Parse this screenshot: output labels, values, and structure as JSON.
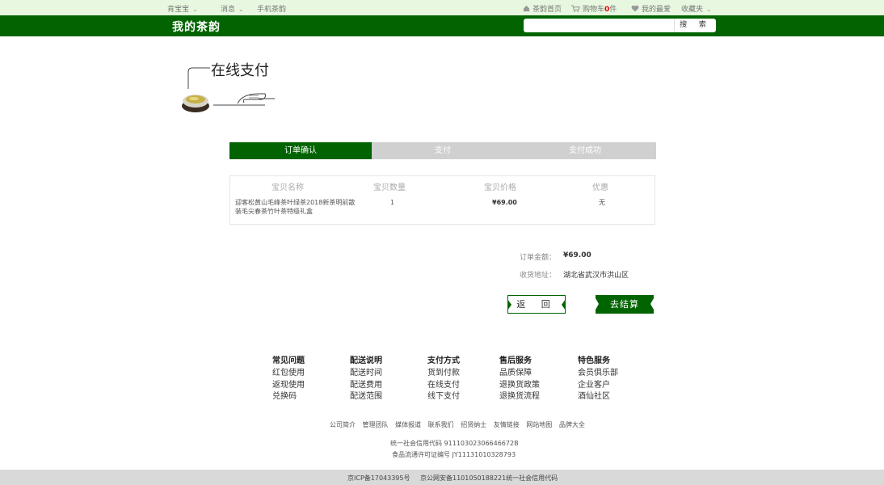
{
  "topbar": {
    "left_items": [
      "肯宝宝",
      "消息",
      "手机茶韵"
    ],
    "home_label": "茶韵首页",
    "cart_label": "购物车",
    "cart_count": "0",
    "cart_unit": "件",
    "favorite_label": "我的最爱",
    "collect_label": "收藏夹"
  },
  "header": {
    "brand": "我的茶韵",
    "search_placeholder": "",
    "search_button": "搜 索"
  },
  "page_title": "在线支付",
  "steps": [
    {
      "label": "订单确认",
      "active": true
    },
    {
      "label": "支付",
      "active": false
    },
    {
      "label": "支付成功",
      "active": false
    }
  ],
  "order_table": {
    "headers": [
      "宝贝名称",
      "宝贝数量",
      "宝贝价格",
      "优惠"
    ],
    "row": {
      "name_line1": "迎客松黄山毛峰茶叶绿茶2018新茶明前散",
      "name_line2": "装毛尖春茶竹叶茶特级礼盒",
      "quantity": "1",
      "price": "¥69.00",
      "discount": "无"
    }
  },
  "summary": {
    "amount_label": "订单金额：",
    "amount_value": "¥69.00",
    "address_label": "收货地址：",
    "address_value": "湖北省武汉市洪山区"
  },
  "buttons": {
    "back": "返 回",
    "checkout": "去结算"
  },
  "footer": {
    "columns": [
      {
        "title": "常见问题",
        "links": [
          "红包使用",
          "返现使用",
          "兑换码"
        ]
      },
      {
        "title": "配送说明",
        "links": [
          "配送时间",
          "配送费用",
          "配送范围"
        ]
      },
      {
        "title": "支付方式",
        "links": [
          "货到付款",
          "在线支付",
          "线下支付"
        ]
      },
      {
        "title": "售后服务",
        "links": [
          "品质保障",
          "退换货政策",
          "退换货流程"
        ]
      },
      {
        "title": "特色服务",
        "links": [
          "会员俱乐部",
          "企业客户",
          "酒仙社区"
        ]
      }
    ],
    "links": [
      "公司简介",
      "管理团队",
      "媒体报道",
      "联系我们",
      "招贤纳士",
      "友情链接",
      "网站地图",
      "品牌大全"
    ],
    "credit_code": "统一社会信用代码  91110302306646672B",
    "food_license": "食品流通许可证编号  JY11131010328793",
    "icp": "京ICP备17043395号",
    "police": "京公网安备1101050188221统一社会信用代码"
  },
  "colors": {
    "brand_green": "#016400",
    "topbar_bg": "#e8f8e0",
    "step_inactive": "#d0d0d0"
  }
}
